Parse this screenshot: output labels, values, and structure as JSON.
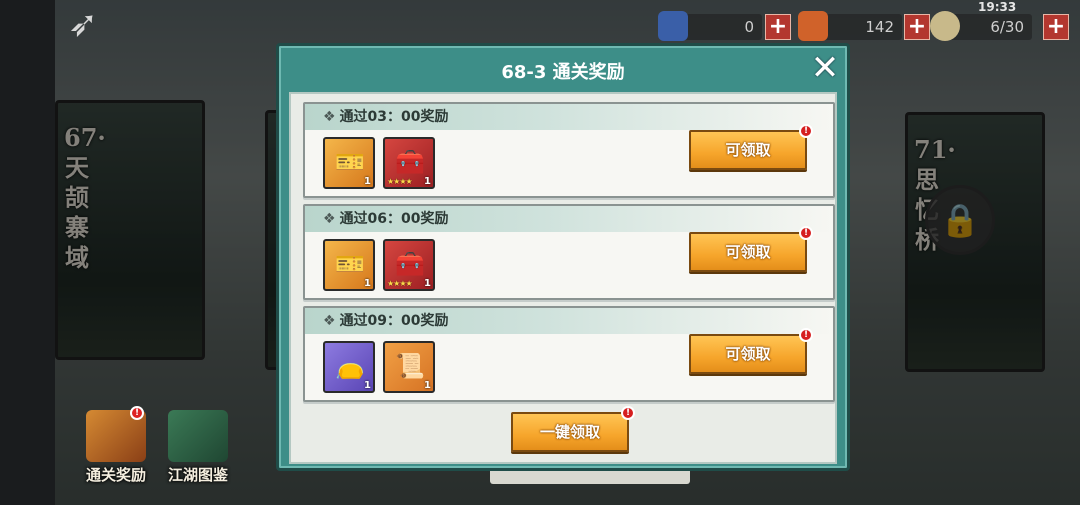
{
  "topbar": {
    "clock": "19:33",
    "resources": [
      {
        "value": "0",
        "icon": "blue-scroll-icon"
      },
      {
        "value": "142",
        "icon": "orange-key-icon"
      },
      {
        "value": "6/30",
        "icon": "bun-icon"
      }
    ]
  },
  "background": {
    "left_card_label": "67·天颉寨域",
    "right_card_label": "71·思忆桥"
  },
  "bottom_buttons": [
    {
      "label": "通关奖励",
      "icon": "treasure-chest-icon"
    },
    {
      "label": "江湖图鉴",
      "icon": "books-icon"
    }
  ],
  "dialog": {
    "title": "68-3 通关奖励",
    "rows": [
      {
        "header": "通过03：00奖励",
        "button": "可领取",
        "items": [
          {
            "icon": "gold-token-icon",
            "qty": "1"
          },
          {
            "icon": "treasure-box-icon",
            "qty": "1",
            "stars": "★★★★"
          }
        ]
      },
      {
        "header": "通过06：00奖励",
        "button": "可领取",
        "items": [
          {
            "icon": "gold-token-icon",
            "qty": "1"
          },
          {
            "icon": "treasure-box-icon",
            "qty": "1",
            "stars": "★★★★"
          }
        ]
      },
      {
        "header": "通过09：00奖励",
        "button": "可领取",
        "items": [
          {
            "icon": "purple-pouch-icon",
            "qty": "1"
          },
          {
            "icon": "scroll-icon",
            "qty": "1"
          }
        ]
      }
    ],
    "claim_all": "一键领取",
    "badge": "!"
  }
}
